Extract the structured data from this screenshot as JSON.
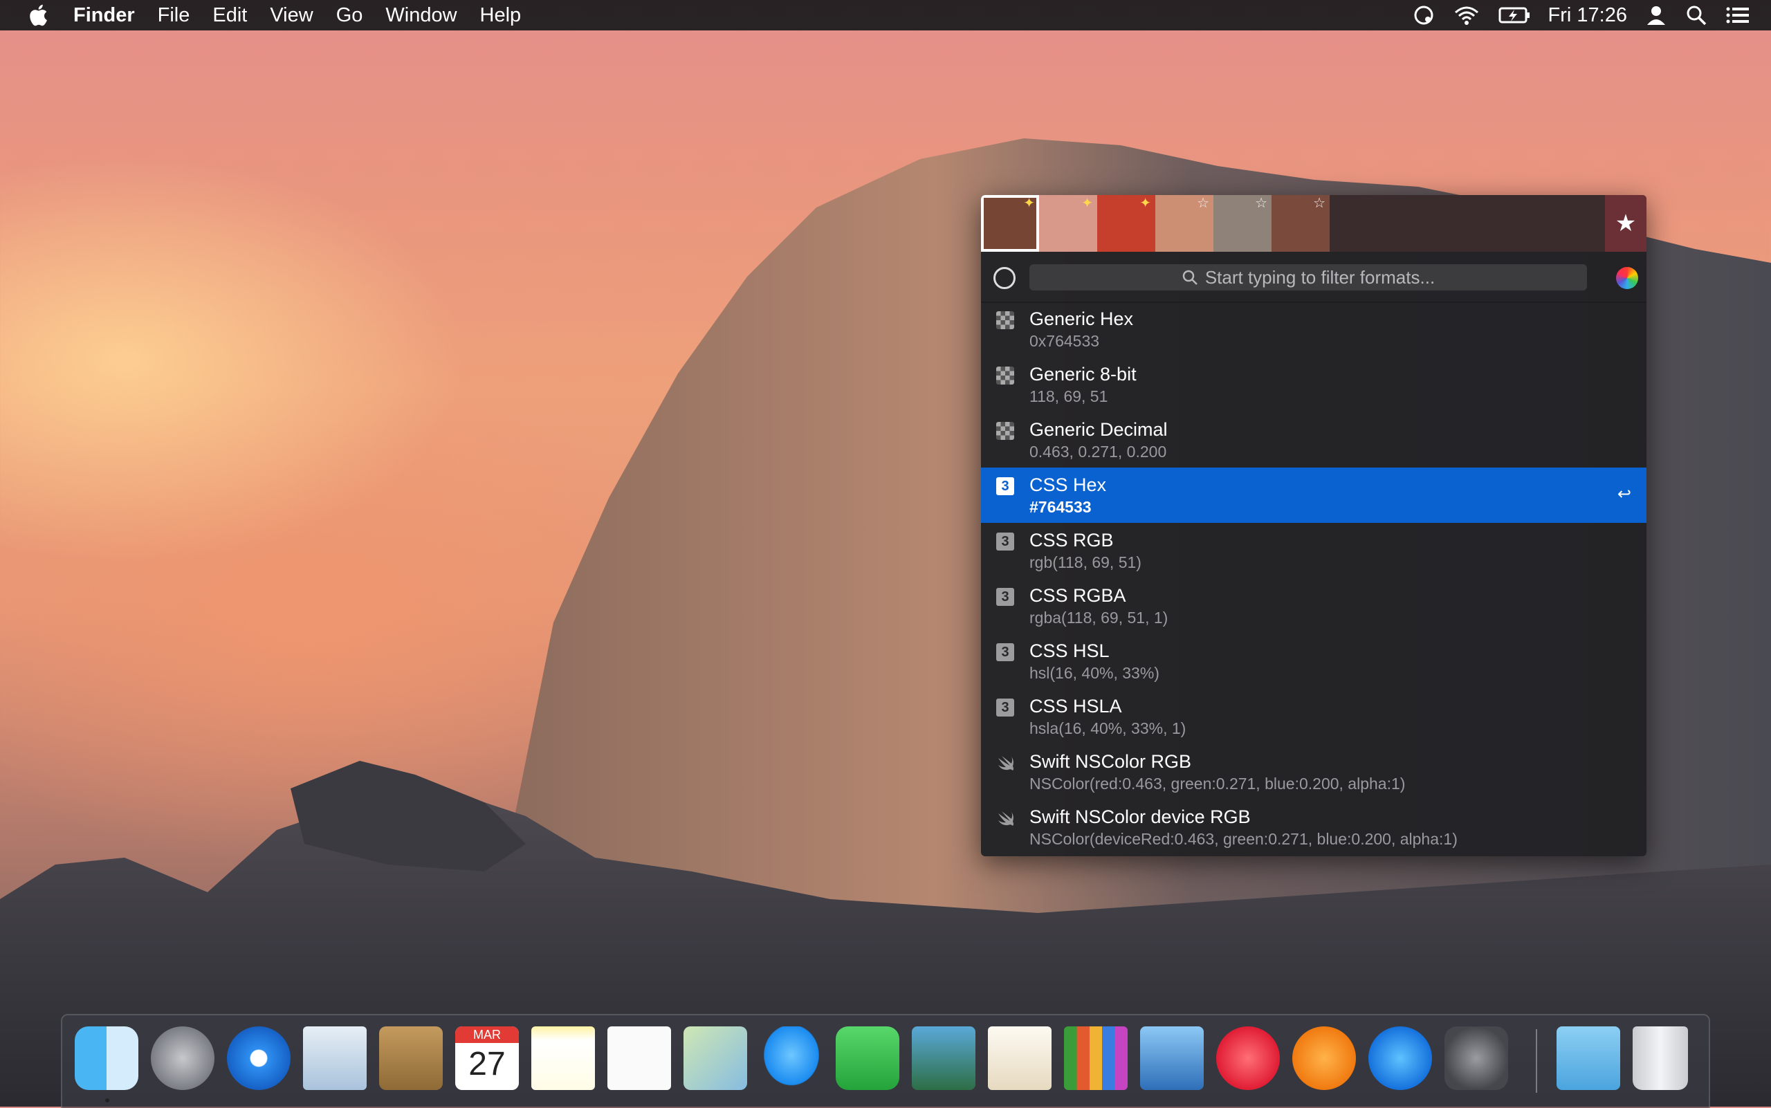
{
  "menubar": {
    "items": [
      "Finder",
      "File",
      "Edit",
      "View",
      "Go",
      "Window",
      "Help"
    ],
    "clock": "Fri 17:26"
  },
  "popup": {
    "swatches": [
      {
        "color": "#764533",
        "star": "spark"
      },
      {
        "color": "#d9998a",
        "star": "spark"
      },
      {
        "color": "#c63f2d",
        "star": "spark"
      },
      {
        "color": "#cd8f73",
        "star": "outline"
      },
      {
        "color": "#8f8379",
        "star": "outline"
      },
      {
        "color": "#7a4a3c",
        "star": "outline"
      }
    ],
    "search_placeholder": "Start typing to filter formats...",
    "formats": [
      {
        "name": "Generic Hex",
        "value": "0x764533",
        "icon": "checker-icon"
      },
      {
        "name": "Generic 8-bit",
        "value": "118, 69, 51",
        "icon": "checker-icon"
      },
      {
        "name": "Generic Decimal",
        "value": "0.463, 0.271, 0.200",
        "icon": "checker-icon"
      },
      {
        "name": "CSS Hex",
        "value": "#764533",
        "icon": "css3-icon",
        "selected": true
      },
      {
        "name": "CSS RGB",
        "value": "rgb(118, 69, 51)",
        "icon": "css3-icon"
      },
      {
        "name": "CSS RGBA",
        "value": "rgba(118, 69, 51, 1)",
        "icon": "css3-icon"
      },
      {
        "name": "CSS HSL",
        "value": "hsl(16, 40%, 33%)",
        "icon": "css3-icon"
      },
      {
        "name": "CSS HSLA",
        "value": "hsla(16, 40%, 33%, 1)",
        "icon": "css3-icon"
      },
      {
        "name": "Swift NSColor RGB",
        "value": "NSColor(red:0.463, green:0.271, blue:0.200, alpha:1)",
        "icon": "swift-icon"
      },
      {
        "name": "Swift NSColor device RGB",
        "value": "NSColor(deviceRed:0.463, green:0.271, blue:0.200, alpha:1)",
        "icon": "swift-icon"
      }
    ]
  },
  "dock": {
    "calendar_month": "MAR",
    "calendar_day": "27",
    "apps": [
      "finder-icon",
      "launchpad-icon",
      "safari-icon",
      "mail-icon",
      "contacts-icon",
      "calendar-icon",
      "notes-icon",
      "reminders-icon",
      "maps-icon",
      "messages-icon",
      "facetime-icon",
      "photo-booth-icon",
      "pages-icon",
      "numbers-icon",
      "keynote-icon",
      "itunes-icon",
      "ibooks-icon",
      "app-store-icon",
      "system-preferences-icon",
      "downloads-folder-icon",
      "trash-icon"
    ]
  }
}
